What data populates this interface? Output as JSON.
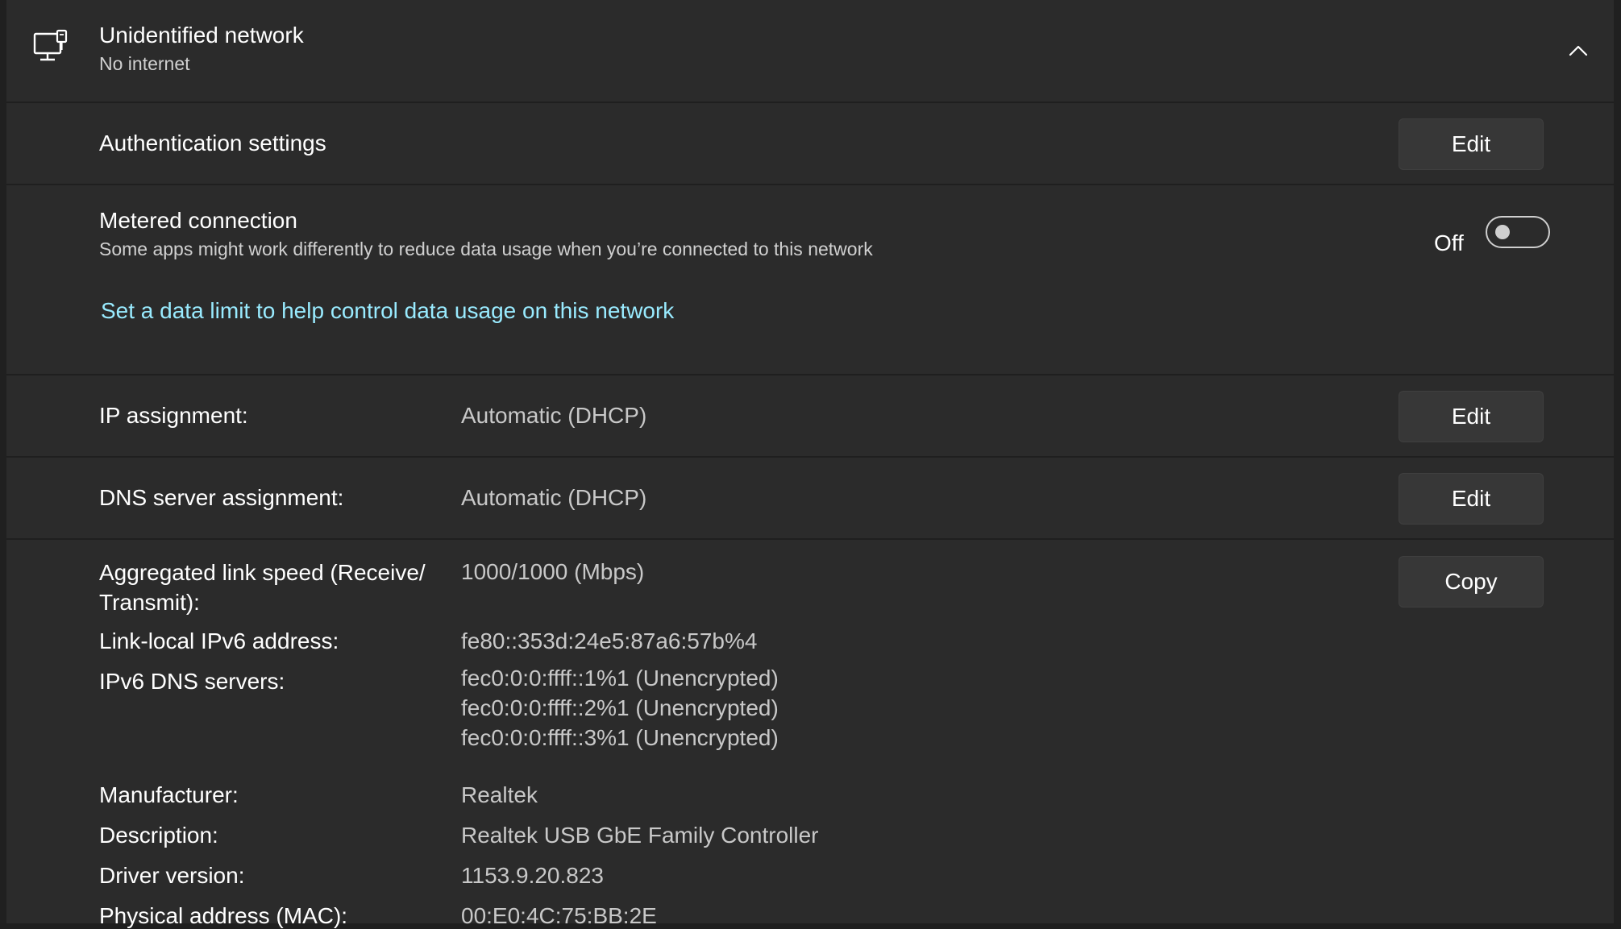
{
  "header": {
    "title": "Unidentified network",
    "subtitle": "No internet",
    "icon": "ethernet-network-icon",
    "collapse_icon": "chevron-up-icon"
  },
  "authentication": {
    "label": "Authentication settings",
    "button": "Edit"
  },
  "metered": {
    "title": "Metered connection",
    "description": "Some apps might work differently to reduce data usage when you’re connected to this network",
    "toggle_state": "Off",
    "link": "Set a data limit to help control data usage on this network"
  },
  "ip_assignment": {
    "label": "IP assignment:",
    "value": "Automatic (DHCP)",
    "button": "Edit"
  },
  "dns_assignment": {
    "label": "DNS server assignment:",
    "value": "Automatic (DHCP)",
    "button": "Edit"
  },
  "details": {
    "copy_button": "Copy",
    "link_speed": {
      "label_line1": "Aggregated link speed (Receive/",
      "label_line2": "Transmit):",
      "value": "1000/1000 (Mbps)"
    },
    "link_local_ipv6": {
      "label": "Link-local IPv6 address:",
      "value": "fe80::353d:24e5:87a6:57b%4"
    },
    "ipv6_dns": {
      "label": "IPv6 DNS servers:",
      "values": [
        "fec0:0:0:ffff::1%1 (Unencrypted)",
        "fec0:0:0:ffff::2%1 (Unencrypted)",
        "fec0:0:0:ffff::3%1 (Unencrypted)"
      ]
    },
    "manufacturer": {
      "label": "Manufacturer:",
      "value": "Realtek"
    },
    "description": {
      "label": "Description:",
      "value": "Realtek USB GbE Family Controller"
    },
    "driver_version": {
      "label": "Driver version:",
      "value": "1153.9.20.823"
    },
    "mac": {
      "label": "Physical address (MAC):",
      "value": "00:E0:4C:75:BB:2E"
    }
  },
  "colors": {
    "background": "#202020",
    "card": "#2b2b2b",
    "button": "#373737",
    "link": "#99ebff",
    "secondary_text": "#c8c8c8"
  }
}
